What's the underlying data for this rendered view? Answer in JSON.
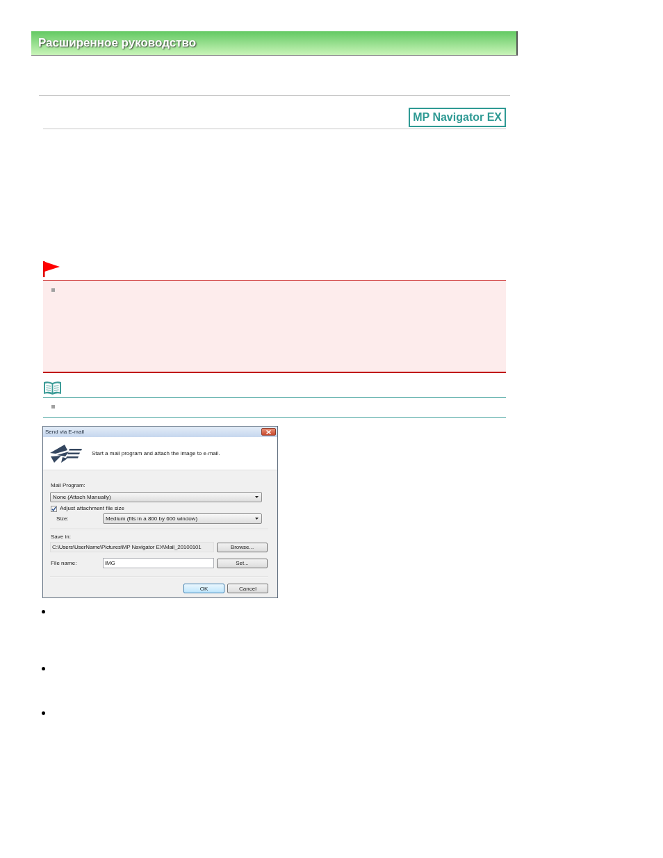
{
  "header": {
    "title": "Расширенное руководство"
  },
  "product_badge": {
    "label": "MP Navigator EX"
  },
  "dialog": {
    "title": "Send via E-mail",
    "description": "Start a mail program and attach the image to e-mail.",
    "mail_program": {
      "label": "Mail Program:",
      "value": "None (Attach Manually)"
    },
    "adjust_size": {
      "label": "Adjust attachment file size",
      "checked": true
    },
    "size": {
      "label": "Size:",
      "value": "Medium (fits in a 800 by 600 window)"
    },
    "save_in": {
      "label": "Save in:",
      "value": "C:\\Users\\UserName\\Pictures\\MP Navigator EX\\Mail_20100101",
      "button": "Browse..."
    },
    "file_name": {
      "label": "File name:",
      "value": "IMG",
      "button": "Set..."
    },
    "buttons": [
      {
        "label": "OK",
        "default": true
      },
      {
        "label": "Cancel",
        "default": false
      }
    ]
  }
}
